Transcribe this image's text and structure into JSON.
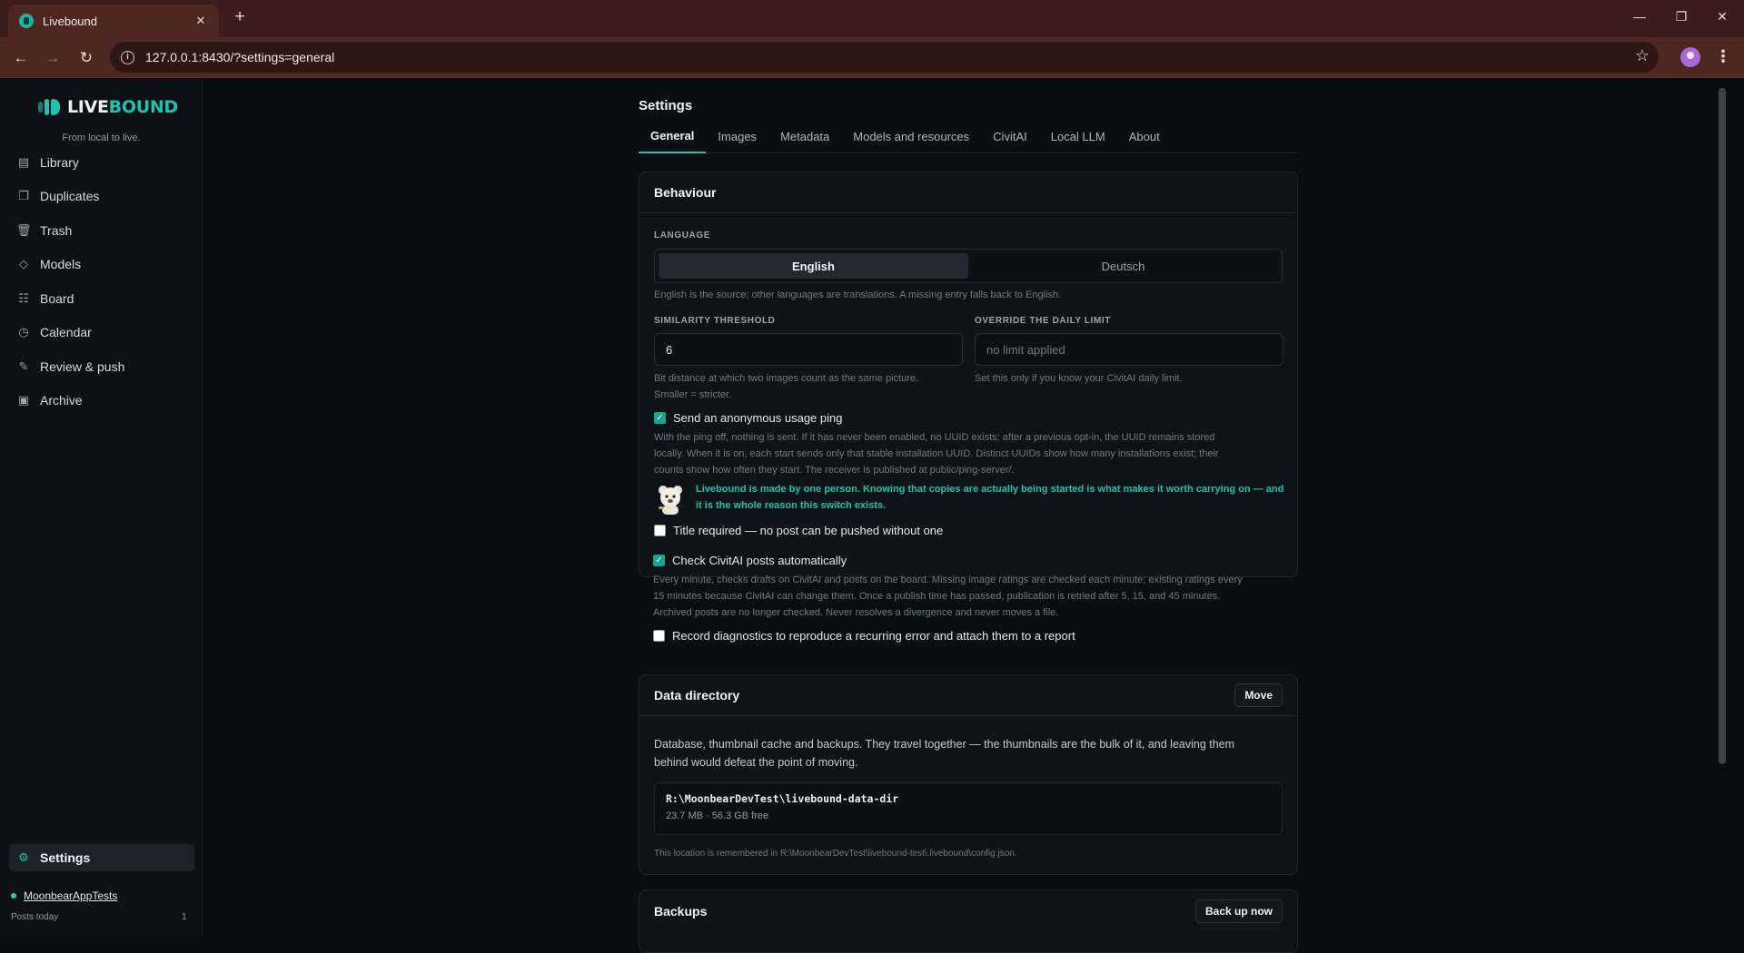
{
  "browser": {
    "tab_title": "Livebound",
    "tab_close": "✕",
    "new_tab": "+",
    "url": "127.0.0.1:8430/?settings=general"
  },
  "sidebar": {
    "logo_a": "LIVE",
    "logo_b": "BOUND",
    "tagline": "From local to live.",
    "items": [
      {
        "label": "Library",
        "icon": "library-icon"
      },
      {
        "label": "Duplicates",
        "icon": "duplicates-icon"
      },
      {
        "label": "Trash",
        "icon": "trash-icon"
      },
      {
        "label": "Models",
        "icon": "models-icon"
      },
      {
        "label": "Board",
        "icon": "board-icon"
      },
      {
        "label": "Calendar",
        "icon": "calendar-icon"
      },
      {
        "label": "Review & push",
        "icon": "review-icon"
      },
      {
        "label": "Archive",
        "icon": "archive-icon"
      }
    ],
    "settings_label": "Settings",
    "account_name": "MoonbearAppTests",
    "posts_today_label": "Posts today",
    "posts_today_count": "1"
  },
  "settings": {
    "title": "Settings",
    "tabs": [
      "General",
      "Images",
      "Metadata",
      "Models and resources",
      "CivitAI",
      "Local LLM",
      "About"
    ],
    "active_tab": "General",
    "behaviour": {
      "title": "Behaviour",
      "language_label": "LANGUAGE",
      "language_options": [
        "English",
        "Deutsch"
      ],
      "language_selected": "English",
      "language_hint": "English is the source; other languages are translations. A missing entry falls back to English.",
      "similarity_label": "SIMILARITY THRESHOLD",
      "similarity_value": "6",
      "similarity_hint_1": "Bit distance at which two images count as the same picture.",
      "similarity_hint_2": "Smaller = stricter.",
      "daily_limit_label": "OVERRIDE THE DAILY LIMIT",
      "daily_limit_placeholder": "no limit applied",
      "daily_limit_hint": "Set this only if you know your CivitAI daily limit.",
      "ping_label": "Send an anonymous usage ping",
      "ping_checked": true,
      "ping_hint_1": "With the ping off, nothing is sent. If it has never been enabled, no UUID exists; after a previous opt-in, the UUID remains stored",
      "ping_hint_2": "locally. When it is on, each start sends only that stable installation UUID. Distinct UUIDs show how many installations exist; their",
      "ping_hint_3": "counts show how often they start. The receiver is published at public/ping-server/.",
      "note_1": "Livebound is made by one person. Knowing that copies are actually being started is what makes it worth carrying on — and",
      "note_2": "it is the whole reason this switch exists.",
      "title_required_label": "Title required — no post can be pushed without one",
      "title_required_checked": false,
      "civitai_check_label": "Check CivitAI posts automatically",
      "civitai_check_checked": true,
      "civitai_hint_1": "Every minute, checks drafts on CivitAI and posts on the board. Missing image ratings are checked each minute; existing ratings every",
      "civitai_hint_2": "15 minutes because CivitAI can change them. Once a publish time has passed, publication is retried after 5, 15, and 45 minutes.",
      "civitai_hint_3": "Archived posts are no longer checked. Never resolves a divergence and never moves a file.",
      "diagnostics_label": "Record diagnostics to reproduce a recurring error and attach them to a report",
      "diagnostics_checked": false
    },
    "data_directory": {
      "title": "Data directory",
      "move_label": "Move",
      "desc_1": "Database, thumbnail cache and backups. They travel together — the thumbnails are the bulk of it, and leaving them",
      "desc_2": "behind would defeat the point of moving.",
      "path": "R:\\MoonbearDevTest\\livebound-data-dir",
      "size": "23.7 MB · 56.3 GB free",
      "remembered": "This location is remembered in R:\\MoonbearDevTest\\livebound-test\\.livebound\\config.json."
    },
    "backups": {
      "title": "Backups",
      "backup_now_label": "Back up now"
    }
  },
  "colors": {
    "accent": "#1fc2ad",
    "browser_frame": "#4e2622",
    "background": "#0a0e12"
  }
}
